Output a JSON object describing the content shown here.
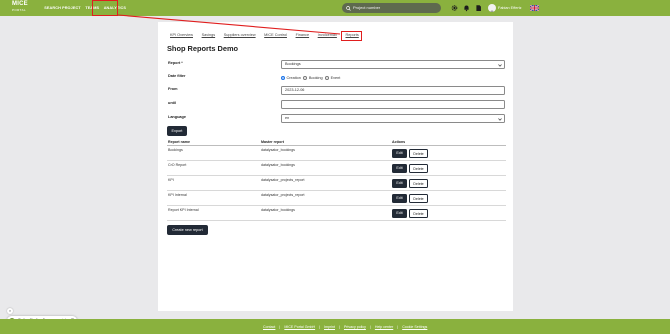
{
  "app": {
    "logo_line1": "MICE",
    "logo_line2": "PORTAL"
  },
  "nav": {
    "items": [
      "SEARCH PROJECT",
      "TEAMS",
      "ANALYTICS"
    ]
  },
  "search": {
    "placeholder": "Project number"
  },
  "user": {
    "name": "Fabian Effertz"
  },
  "tabs": [
    "KPI Overview",
    "Savings",
    "Suppliers overview",
    "MICE Control",
    "Finance",
    "Invoicemax",
    "Reports"
  ],
  "page": {
    "title": "Shop Reports Demo"
  },
  "form": {
    "report_label": "Report *",
    "report_value": "Bookings",
    "date_filter_label": "Date filter",
    "date_filter_options": [
      "Creation",
      "Booking",
      "Event"
    ],
    "date_filter_selected": "Creation",
    "from_label": "From",
    "from_value": "2023-12-06",
    "until_label": "until",
    "until_value": "",
    "language_label": "Language",
    "language_value": "en",
    "export_button": "Export"
  },
  "table": {
    "headers": [
      "Report name",
      "Master report",
      "Actions"
    ],
    "rows": [
      {
        "name": "Bookings",
        "master": "datalysator_bookings"
      },
      {
        "name": "CrO Report",
        "master": "datalysator_bookings"
      },
      {
        "name": "KPI",
        "master": "datalysator_projects_report"
      },
      {
        "name": "KPI Internal",
        "master": "datalysator_projects_report"
      },
      {
        "name": "Report KPI Internal",
        "master": "datalysator_bookings"
      }
    ],
    "edit_label": "Edit",
    "delete_label": "Delete",
    "create_button": "Create new report"
  },
  "chat": {
    "message": "Stellen Sie Ihre Fragen an mich ...",
    "close_label": "×"
  },
  "footer": {
    "links": [
      "Contact",
      "MICE Portal GmbH",
      "Imprint",
      "Privacy policy",
      "Help center",
      "Cookie Settings"
    ]
  },
  "colors": {
    "brand_green": "#8ab13e",
    "dark_button": "#222a36",
    "annotation_red": "#e01e1e"
  }
}
